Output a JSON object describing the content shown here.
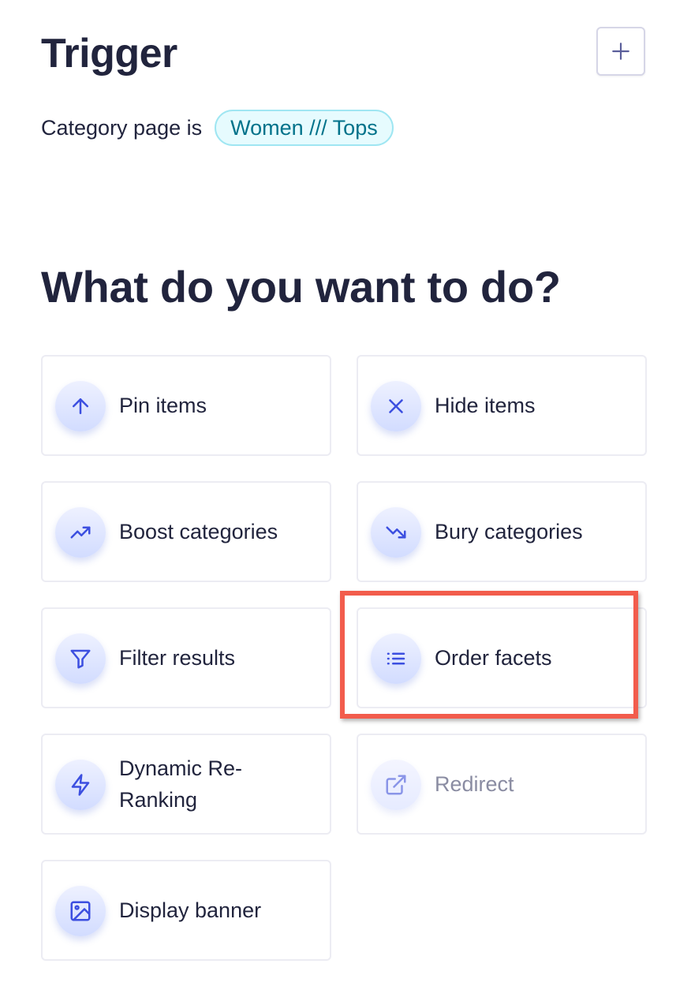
{
  "trigger": {
    "title": "Trigger",
    "add_button_icon": "plus-icon",
    "condition_label": "Category page is",
    "condition_value": "Women /// Tops"
  },
  "actions_section": {
    "title": "What do you want to do?",
    "items": [
      {
        "label": "Pin items",
        "icon": "arrow-up-icon"
      },
      {
        "label": "Hide items",
        "icon": "x-icon"
      },
      {
        "label": "Boost categories",
        "icon": "trending-up-icon"
      },
      {
        "label": "Bury categories",
        "icon": "trending-down-icon"
      },
      {
        "label": "Filter results",
        "icon": "filter-icon"
      },
      {
        "label": "Order facets",
        "icon": "list-icon"
      },
      {
        "label": "Dynamic Re-Ranking",
        "icon": "lightning-icon"
      },
      {
        "label": "Redirect",
        "icon": "external-link-icon"
      },
      {
        "label": "Display banner",
        "icon": "image-icon"
      }
    ]
  },
  "colors": {
    "text": "#21243d",
    "icon_accent": "#3c4fe0",
    "tag_text": "#00728a",
    "tag_background": "#e6fbfe",
    "highlight": "#f25c4c",
    "disabled_text": "#8a8ca2"
  }
}
